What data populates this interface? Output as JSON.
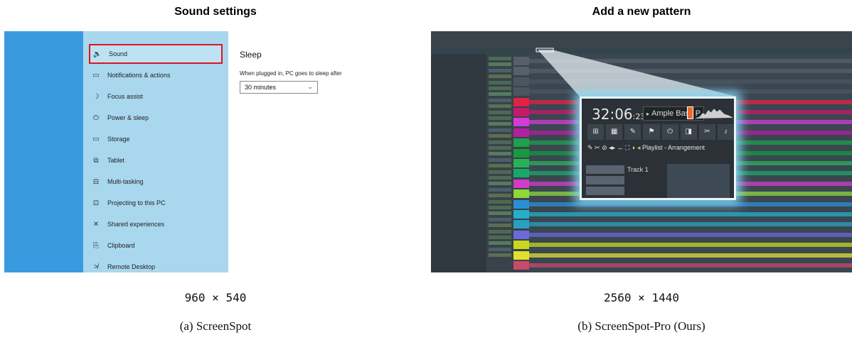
{
  "panels": {
    "left": {
      "title": "Sound settings",
      "dims": "960 × 540",
      "caption": "(a) ScreenSpot",
      "sidebar": {
        "items": [
          {
            "label": "Sound",
            "icon": "speaker-icon",
            "glyph": "🔈",
            "selected": true
          },
          {
            "label": "Notifications & actions",
            "icon": "notification-icon",
            "glyph": "▭",
            "selected": false
          },
          {
            "label": "Focus assist",
            "icon": "moon-icon",
            "glyph": "☽",
            "selected": false
          },
          {
            "label": "Power & sleep",
            "icon": "power-icon",
            "glyph": "⏻",
            "selected": false
          },
          {
            "label": "Storage",
            "icon": "storage-icon",
            "glyph": "▭",
            "selected": false
          },
          {
            "label": "Tablet",
            "icon": "tablet-icon",
            "glyph": "⧉",
            "selected": false
          },
          {
            "label": "Multi-tasking",
            "icon": "multitask-icon",
            "glyph": "⊟",
            "selected": false
          },
          {
            "label": "Projecting to this PC",
            "icon": "projector-icon",
            "glyph": "⊡",
            "selected": false
          },
          {
            "label": "Shared experiences",
            "icon": "share-icon",
            "glyph": "✕",
            "selected": false
          },
          {
            "label": "Clipboard",
            "icon": "clipboard-icon",
            "glyph": "⎘",
            "selected": false
          },
          {
            "label": "Remote Desktop",
            "icon": "remote-icon",
            "glyph": "≯",
            "selected": false
          }
        ]
      },
      "content": {
        "heading": "Sleep",
        "label": "When plugged in, PC goes to sleep after",
        "dropdown_value": "30 minutes"
      },
      "colors": {
        "highlight": "#e0141e"
      }
    },
    "right": {
      "title": "Add a new pattern",
      "dims": "2560 × 1440",
      "caption": "(b) ScreenSpot-Pro (Ours)",
      "zoom": {
        "time": "32:06",
        "time_small": ":23",
        "instrument": "Ample Bass P",
        "playlist_label": "Playlist - Arrangement",
        "track_label": "Track 1"
      }
    }
  }
}
